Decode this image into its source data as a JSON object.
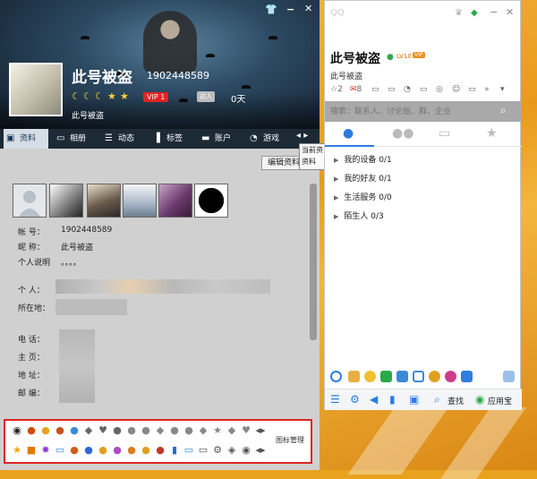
{
  "profile": {
    "nickname": "此号被盗",
    "qq_number": "1902448589",
    "vip_label": "VIP 1",
    "days_badge": "达人",
    "days_value": "0天",
    "signature": "此号被盗",
    "tabs": [
      {
        "label": "资料",
        "icon": "id-card-icon"
      },
      {
        "label": "相册",
        "icon": "photo-album-icon"
      },
      {
        "label": "动态",
        "icon": "feed-icon"
      },
      {
        "label": "标签",
        "icon": "tag-icon"
      },
      {
        "label": "账户",
        "icon": "wallet-icon"
      },
      {
        "label": "游戏",
        "icon": "game-icon"
      }
    ],
    "edit_button": "编辑资料",
    "tooltip_line1": "当前资",
    "tooltip_line2": "资料",
    "fields": [
      {
        "label": "帐    号：",
        "value": "1902448589"
      },
      {
        "label": "昵    称：",
        "value": "此号被盗"
      },
      {
        "label": "个人说明",
        "value": "。。。。"
      },
      {
        "label": "个    人：",
        "value": ""
      },
      {
        "label": "所在地：",
        "value": ""
      },
      {
        "label": "电    话：",
        "value": ""
      },
      {
        "label": "主    页：",
        "value": ""
      },
      {
        "label": "地    址：",
        "value": ""
      },
      {
        "label": "邮    编：",
        "value": ""
      }
    ],
    "iconbar_label": "图标管理"
  },
  "qq": {
    "logo": "QQ",
    "nickname": "此号被盗",
    "level_badge": "LV10",
    "signature": "此号被盗",
    "toolbar_counts": {
      "a": "2",
      "b": "8"
    },
    "search_placeholder": "搜索：联系人、讨论组、群、企业",
    "groups": [
      {
        "label": "我的设备",
        "count": "0/1"
      },
      {
        "label": "我的好友",
        "count": "0/1"
      },
      {
        "label": "生活服务",
        "count": "0/0"
      },
      {
        "label": "陌生人",
        "count": "0/3"
      }
    ],
    "bottom_find": "查找",
    "bottom_appstore": "应用宝"
  }
}
